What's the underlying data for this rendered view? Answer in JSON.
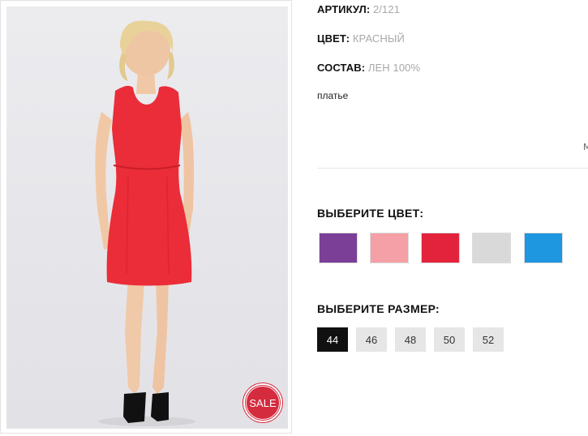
{
  "product": {
    "sale_badge": "SALE",
    "specs": {
      "article_label": "АРТИКУЛ:",
      "article_value": "2/121",
      "color_label": "ЦВЕТ:",
      "color_value": "КРАСНЫЙ",
      "composition_label": "СОСТАВ:",
      "composition_value": "ЛЕН 100%"
    },
    "description": "платье",
    "clipped_text": "М"
  },
  "color_picker": {
    "title": "ВЫБЕРИТЕ ЦВЕТ:",
    "swatches": [
      {
        "name": "purple",
        "color": "#7b3f98"
      },
      {
        "name": "pink",
        "color": "#f4a0a6"
      },
      {
        "name": "red",
        "color": "#e3233c"
      },
      {
        "name": "grey",
        "color": "#d9d9d9"
      },
      {
        "name": "blue",
        "color": "#1e96e0"
      }
    ]
  },
  "size_picker": {
    "title": "ВЫБЕРИТЕ РАЗМЕР:",
    "sizes": [
      "44",
      "46",
      "48",
      "50",
      "52"
    ],
    "selected": "44"
  }
}
